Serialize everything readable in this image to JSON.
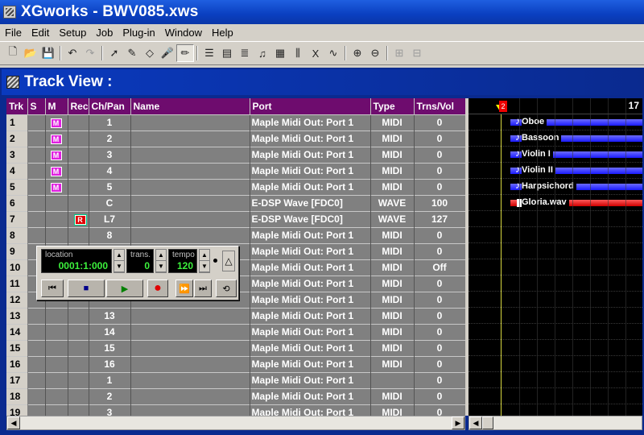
{
  "window": {
    "title": "XGworks - BWV085.xws"
  },
  "menu": [
    "File",
    "Edit",
    "Setup",
    "Job",
    "Plug-in",
    "Window",
    "Help"
  ],
  "toolbar": {
    "icons": [
      "new-file-icon",
      "open-folder-icon",
      "save-icon",
      "undo-icon",
      "redo-icon",
      "pointer-icon",
      "pencil-icon",
      "eraser-icon",
      "microphone-icon",
      "edit-pen-icon",
      "track-view-icon",
      "piano-roll-icon",
      "event-list-icon",
      "score-icon",
      "drum-icon",
      "mixer-icon",
      "xg-icon",
      "wave-icon",
      "zoom-in-icon",
      "zoom-out-icon",
      "zoom-in-v-icon",
      "zoom-out-v-icon"
    ]
  },
  "track_view": {
    "title": "Track View :",
    "columns": [
      "Trk",
      "S",
      "M",
      "Rec",
      "Ch/Pan",
      "Name",
      "Port",
      "Type",
      "Trns/Vol"
    ],
    "rows": [
      {
        "trk": "1",
        "m": "M",
        "rec": "",
        "ch": "1",
        "name": "",
        "port": "Maple Midi Out: Port 1",
        "type": "MIDI",
        "vol": "0"
      },
      {
        "trk": "2",
        "m": "M",
        "rec": "",
        "ch": "2",
        "name": "",
        "port": "Maple Midi Out: Port 1",
        "type": "MIDI",
        "vol": "0"
      },
      {
        "trk": "3",
        "m": "M",
        "rec": "",
        "ch": "3",
        "name": "",
        "port": "Maple Midi Out: Port 1",
        "type": "MIDI",
        "vol": "0"
      },
      {
        "trk": "4",
        "m": "M",
        "rec": "",
        "ch": "4",
        "name": "",
        "port": "Maple Midi Out: Port 1",
        "type": "MIDI",
        "vol": "0"
      },
      {
        "trk": "5",
        "m": "M",
        "rec": "",
        "ch": "5",
        "name": "",
        "port": "Maple Midi Out: Port 1",
        "type": "MIDI",
        "vol": "0"
      },
      {
        "trk": "6",
        "m": "",
        "rec": "",
        "ch": "C",
        "name": "",
        "port": "E-DSP Wave [FDC0]",
        "type": "WAVE",
        "vol": "100"
      },
      {
        "trk": "7",
        "m": "",
        "rec": "R",
        "ch": "L7",
        "name": "",
        "port": "E-DSP Wave [FDC0]",
        "type": "WAVE",
        "vol": "127"
      },
      {
        "trk": "8",
        "m": "",
        "rec": "",
        "ch": "8",
        "name": "",
        "port": "Maple Midi Out: Port 1",
        "type": "MIDI",
        "vol": "0"
      },
      {
        "trk": "9",
        "m": "",
        "rec": "",
        "ch": "",
        "name": "",
        "port": "Maple Midi Out: Port 1",
        "type": "MIDI",
        "vol": "0"
      },
      {
        "trk": "10",
        "m": "",
        "rec": "",
        "ch": "",
        "name": "",
        "port": "Maple Midi Out: Port 1",
        "type": "MIDI",
        "vol": "Off"
      },
      {
        "trk": "11",
        "m": "",
        "rec": "",
        "ch": "",
        "name": "",
        "port": "Maple Midi Out: Port 1",
        "type": "MIDI",
        "vol": "0"
      },
      {
        "trk": "12",
        "m": "",
        "rec": "",
        "ch": "",
        "name": "",
        "port": "Maple Midi Out: Port 1",
        "type": "MIDI",
        "vol": "0"
      },
      {
        "trk": "13",
        "m": "",
        "rec": "",
        "ch": "13",
        "name": "",
        "port": "Maple Midi Out: Port 1",
        "type": "MIDI",
        "vol": "0"
      },
      {
        "trk": "14",
        "m": "",
        "rec": "",
        "ch": "14",
        "name": "",
        "port": "Maple Midi Out: Port 1",
        "type": "MIDI",
        "vol": "0"
      },
      {
        "trk": "15",
        "m": "",
        "rec": "",
        "ch": "15",
        "name": "",
        "port": "Maple Midi Out: Port 1",
        "type": "MIDI",
        "vol": "0"
      },
      {
        "trk": "16",
        "m": "",
        "rec": "",
        "ch": "16",
        "name": "",
        "port": "Maple Midi Out: Port 1",
        "type": "MIDI",
        "vol": "0"
      },
      {
        "trk": "17",
        "m": "",
        "rec": "",
        "ch": "1",
        "name": "",
        "port": "Maple Midi Out: Port 1",
        "type": "",
        "vol": "0"
      },
      {
        "trk": "18",
        "m": "",
        "rec": "",
        "ch": "2",
        "name": "",
        "port": "Maple Midi Out: Port 1",
        "type": "MIDI",
        "vol": "0"
      },
      {
        "trk": "19",
        "m": "",
        "rec": "",
        "ch": "3",
        "name": "",
        "port": "Maple Midi Out: Port 1",
        "type": "MIDI",
        "vol": "0"
      }
    ]
  },
  "timeline": {
    "measure_marker": "2",
    "measure_end": "17",
    "clips": [
      {
        "name": "Oboe",
        "kind": "midi",
        "color": "#2020ff"
      },
      {
        "name": "Bassoon",
        "kind": "midi",
        "color": "#2020ff"
      },
      {
        "name": "Violin I",
        "kind": "midi",
        "color": "#2020ff"
      },
      {
        "name": "Violin II",
        "kind": "midi",
        "color": "#2020ff"
      },
      {
        "name": "Harpsichord",
        "kind": "midi",
        "color": "#2020ff"
      },
      {
        "name": "Gloria.wav",
        "kind": "wave",
        "color": "#e00000"
      }
    ]
  },
  "transport": {
    "location_label": "location",
    "location_value": "0001:1:000",
    "trans_label": "trans.",
    "trans_value": "0",
    "tempo_label": "tempo",
    "tempo_value": "120"
  }
}
